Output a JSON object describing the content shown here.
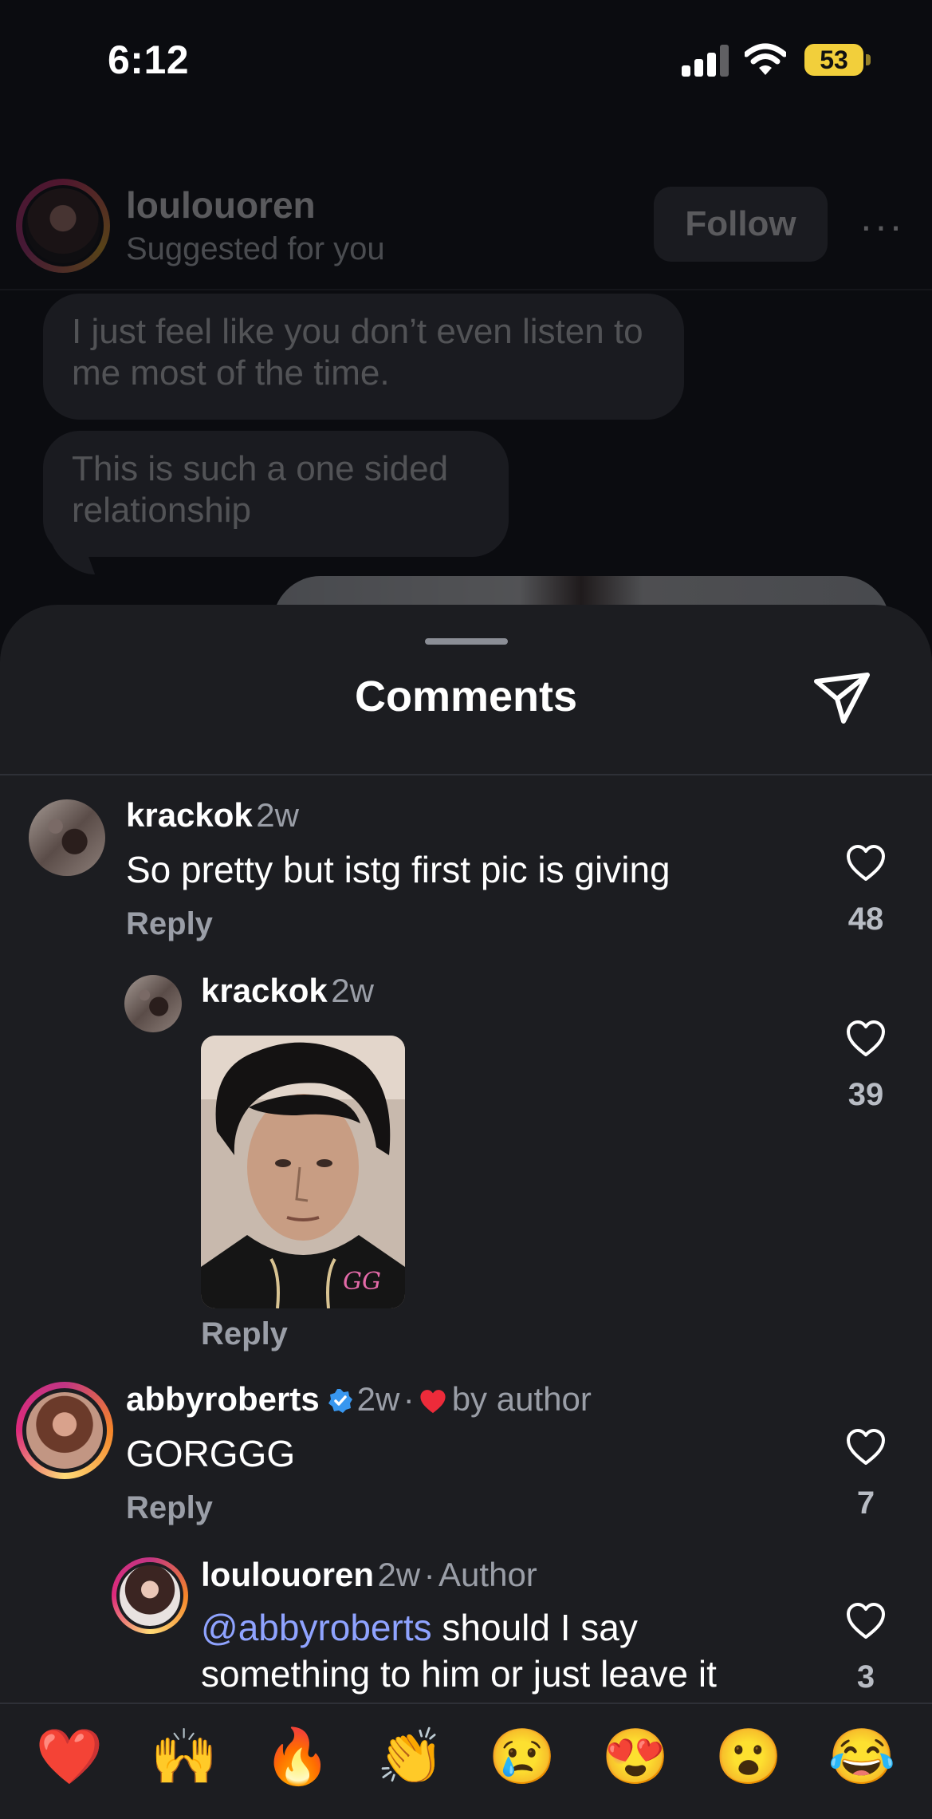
{
  "status_bar": {
    "time": "6:12",
    "battery": "53"
  },
  "background_post": {
    "username": "loulouoren",
    "subtitle": "Suggested for you",
    "follow_label": "Follow",
    "more": "···",
    "messages": [
      "I just feel like you don’t even listen to me most of the time.",
      "This is such a one sided relationship"
    ]
  },
  "sheet": {
    "title": "Comments"
  },
  "comments": [
    {
      "username": "krackok",
      "time": "2w",
      "text": "So pretty but istg first pic is giving",
      "reply_label": "Reply",
      "likes": "48"
    },
    {
      "username": "krackok",
      "time": "2w",
      "text": "",
      "reply_label": "Reply",
      "likes": "39",
      "gif_watermark": "GG"
    },
    {
      "username": "abbyroberts",
      "time": "2w",
      "separator": "·",
      "liked_by": "by author",
      "text": "GORGGG",
      "reply_label": "Reply",
      "likes": "7"
    },
    {
      "username": "loulouoren",
      "time": "2w",
      "separator": "·",
      "badge": "Author",
      "mention": "@abbyroberts",
      "text_line1": " should I say",
      "text_line2": "something to him or just leave it",
      "likes": "3"
    }
  ],
  "emoji_bar": [
    "❤️",
    "🙌",
    "🔥",
    "👏",
    "😢",
    "😍",
    "😮",
    "😂"
  ],
  "colors": {
    "sheet_bg": "#1c1d21",
    "mention": "#8fa3ff",
    "verified": "#3897f0",
    "heart_red": "#ed2b3a"
  },
  "icons": [
    "signal-icon",
    "wifi-icon",
    "battery-icon",
    "send-icon",
    "heart-outline-icon",
    "verified-badge-icon",
    "heart-filled-icon"
  ]
}
